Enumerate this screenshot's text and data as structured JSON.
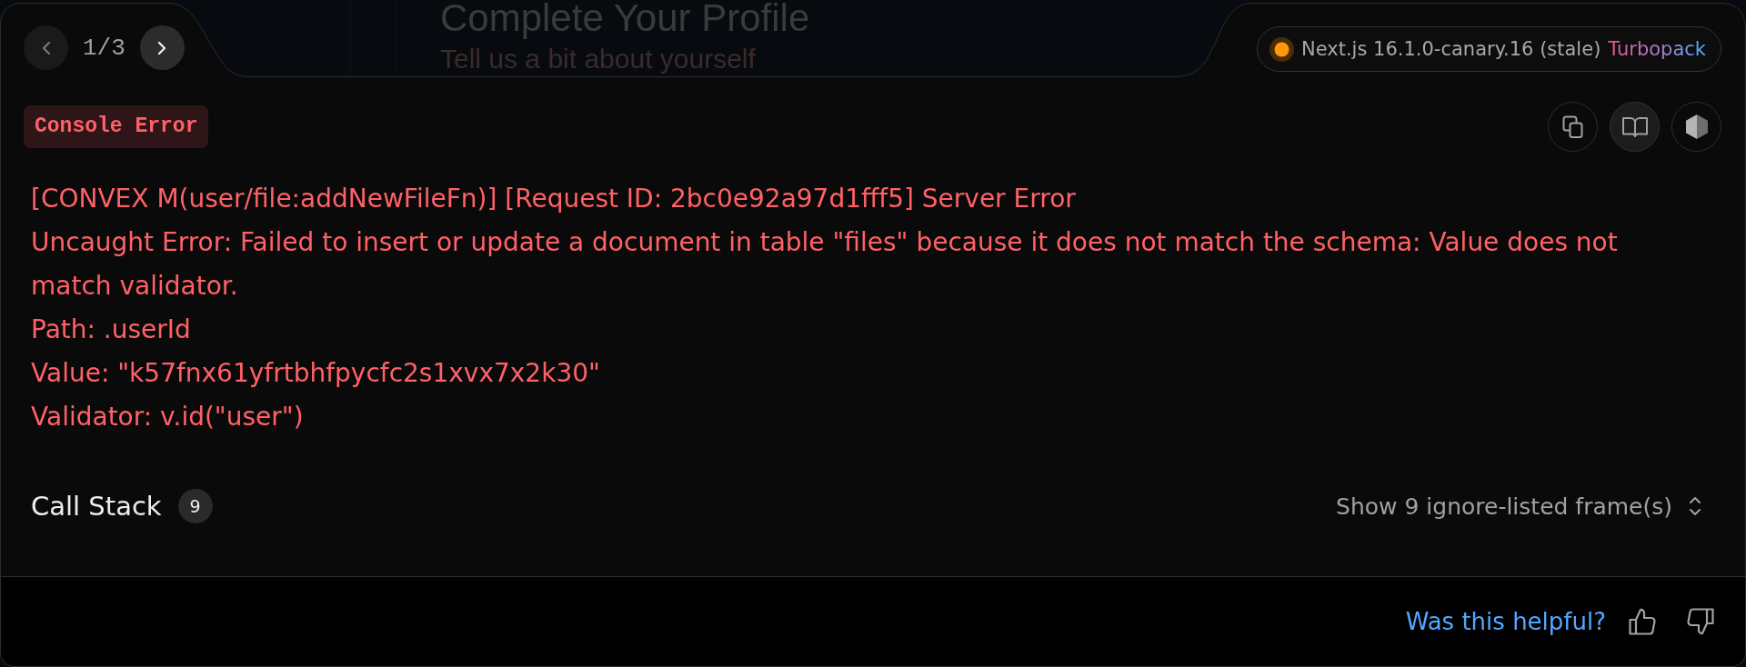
{
  "background_page": {
    "title": "Complete Your Profile",
    "subtitle": "Tell us a bit about yourself"
  },
  "pager": {
    "prev": {
      "disabled": true
    },
    "position": "1/3",
    "next": {
      "disabled": false
    }
  },
  "version": {
    "label": "Next.js 16.1.0-canary.16 (stale)",
    "bundler": "Turbopack"
  },
  "error_type": "Console Error",
  "toolbar": [
    {
      "kind": "copy",
      "hovered": false
    },
    {
      "kind": "docs",
      "hovered": true
    },
    {
      "kind": "hexagon",
      "hovered": false
    }
  ],
  "message": [
    "[CONVEX M(user/file:addNewFileFn)] [Request ID: 2bc0e92a97d1fff5] Server Error",
    "Uncaught Error: Failed to insert or update a document in table \"files\" because it does not match the schema: Value does not match validator.",
    "Path: .userId",
    "Value: \"k57fnx61yfrtbhfpycfc2s1xvx7x2k30\"",
    "Validator: v.id(\"user\")"
  ],
  "call_stack": {
    "title": "Call Stack",
    "count": "9",
    "toggle": "Show 9 ignore-listed frame(s)"
  },
  "footer": {
    "question": "Was this helpful?"
  }
}
